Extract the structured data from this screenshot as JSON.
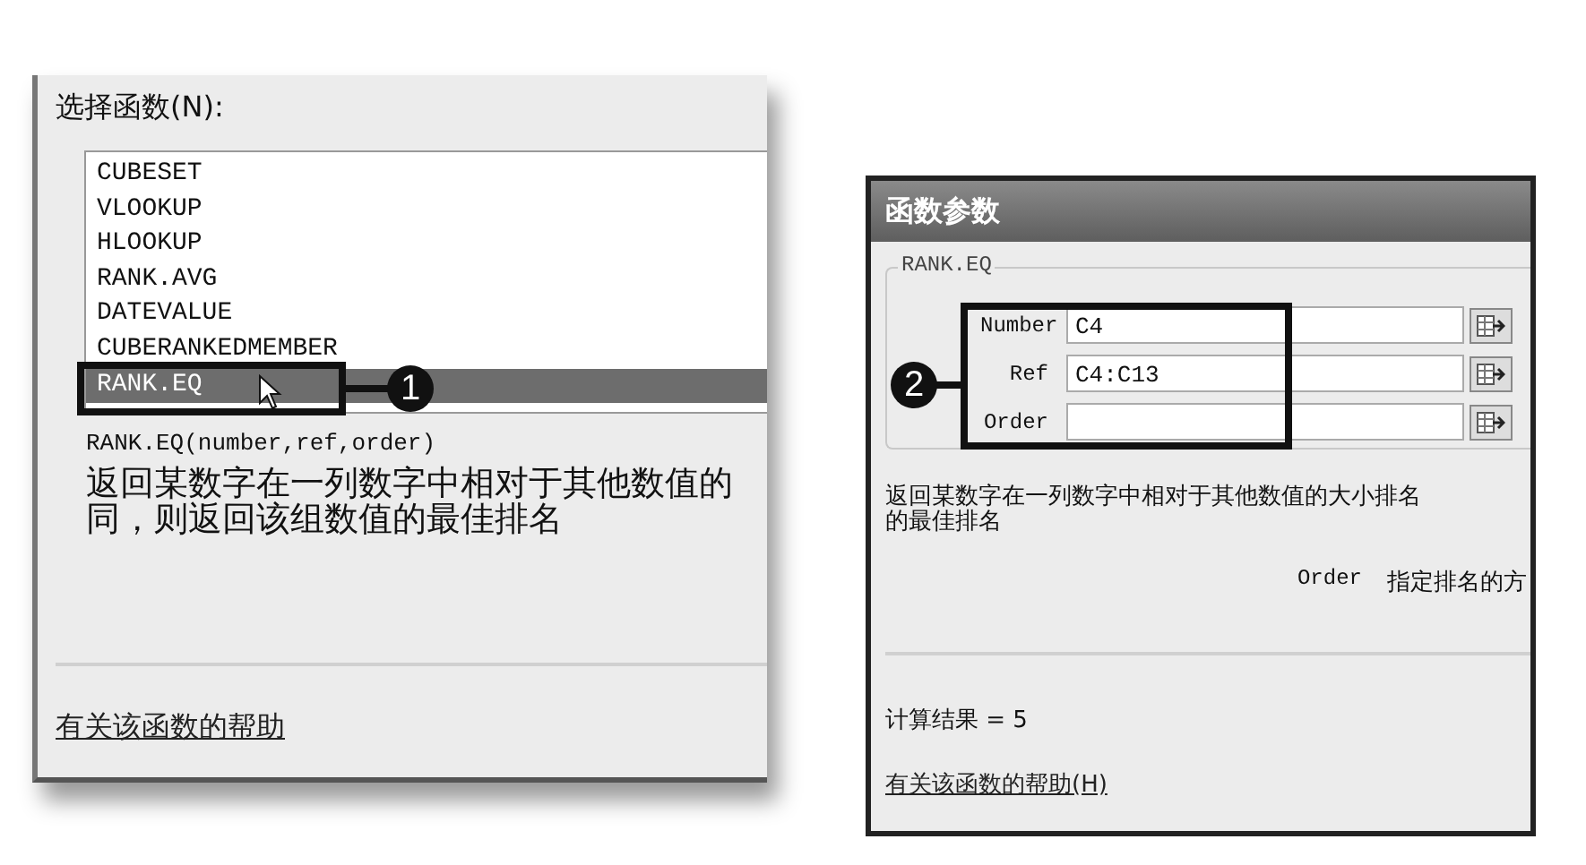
{
  "left_dialog": {
    "list_label": "选择函数(N):",
    "functions": [
      {
        "name": "CUBESET",
        "selected": false
      },
      {
        "name": "VLOOKUP",
        "selected": false
      },
      {
        "name": "HLOOKUP",
        "selected": false
      },
      {
        "name": "RANK.AVG",
        "selected": false
      },
      {
        "name": "DATEVALUE",
        "selected": false
      },
      {
        "name": "CUBERANKEDMEMBER",
        "selected": false
      },
      {
        "name": "RANK.EQ",
        "selected": true
      }
    ],
    "signature": "RANK.EQ(number,ref,order)",
    "description_lines": [
      "返回某数字在一列数字中相对于其他数值的",
      "同，则返回该组数值的最佳排名"
    ],
    "help_link": "有关该函数的帮助"
  },
  "right_dialog": {
    "title": "函数参数",
    "group_label": "RANK.EQ",
    "arguments": [
      {
        "label": "Number",
        "value": "C4"
      },
      {
        "label": "Ref",
        "value": "C4:C13"
      },
      {
        "label": "Order"
      }
    ],
    "description_lines": [
      "返回某数字在一列数字中相对于其他数值的大小排名",
      "的最佳排名"
    ],
    "argument_help": {
      "name": "Order",
      "text": "指定排名的方"
    },
    "result": "计算结果 = 5",
    "help_link": "有关该函数的帮助(H)"
  },
  "callouts": [
    {
      "number": "1"
    },
    {
      "number": "2"
    }
  ]
}
